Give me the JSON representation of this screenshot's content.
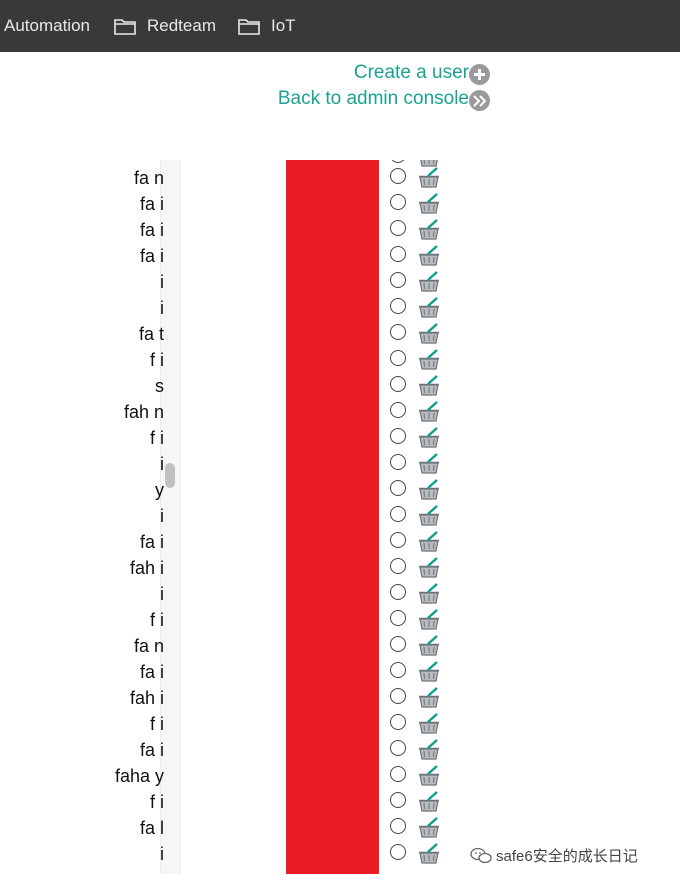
{
  "bookmarks": [
    {
      "label": "Automation",
      "icon": "folder-icon",
      "has_icon": false
    },
    {
      "label": "Redteam",
      "icon": "folder-icon",
      "has_icon": true
    },
    {
      "label": "IoT",
      "icon": "folder-icon",
      "has_icon": true
    }
  ],
  "links": {
    "create_user": "Create a user",
    "back_to_console": "Back to admin console"
  },
  "colors": {
    "link": "#1aa393",
    "redaction": "#ec1c24",
    "bookmark_bar": "#38393b"
  },
  "users": [
    "fa                    n",
    "fa                    i",
    "fa                    i",
    "fa                    i",
    "i",
    "i",
    "fa                    t",
    "f                    i",
    "s",
    "fah                    n",
    "f                    i",
    "i",
    "y",
    "i",
    "fa                    i",
    "fah                    i",
    "i",
    "f                    i",
    "fa                    n",
    "fa                    i",
    "fah                    i",
    "f                    i",
    "fa                    i",
    "faha                    y",
    "f                    i",
    "fa                    l",
    "i"
  ],
  "watermark": "safe6安全的成长日记"
}
